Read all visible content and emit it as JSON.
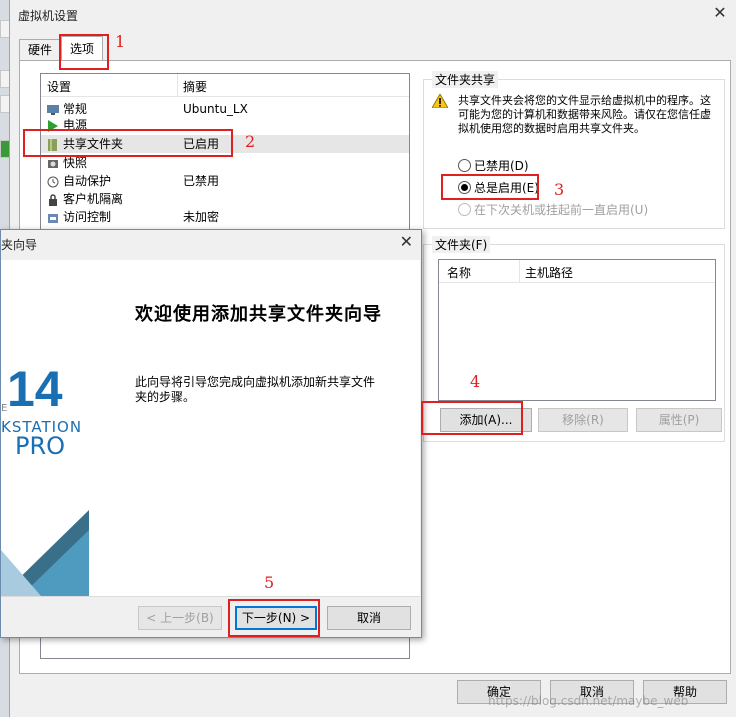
{
  "main_window": {
    "title": "虚拟机设置",
    "tabs": [
      {
        "label": "硬件"
      },
      {
        "label": "选项"
      }
    ],
    "settings_list": {
      "columns": [
        "设置",
        "摘要"
      ],
      "rows": [
        {
          "name": "常规",
          "summary": "Ubuntu_LX",
          "icon": "monitor-icon"
        },
        {
          "name": "电源",
          "summary": "",
          "icon": "play-icon"
        },
        {
          "name": "共享文件夹",
          "summary": "已启用",
          "icon": "shared-folder-icon"
        },
        {
          "name": "快照",
          "summary": "",
          "icon": "snapshot-icon"
        },
        {
          "name": "自动保护",
          "summary": "已禁用",
          "icon": "clock-icon"
        },
        {
          "name": "客户机隔离",
          "summary": "",
          "icon": "lock-icon"
        },
        {
          "name": "访问控制",
          "summary": "未加密",
          "icon": "access-control-icon"
        }
      ]
    },
    "folder_sharing": {
      "group_label": "文件夹共享",
      "warning": "共享文件夹会将您的文件显示给虚拟机中的程序。这可能为您的计算机和数据带来风险。请仅在您信任虚拟机使用您的数据时启用共享文件夹。",
      "options": [
        {
          "label": "已禁用(D)",
          "selected": false,
          "disabled": false
        },
        {
          "label": "总是启用(E)",
          "selected": true,
          "disabled": false
        },
        {
          "label": "在下次关机或挂起前一直启用(U)",
          "selected": false,
          "disabled": true
        }
      ]
    },
    "folders": {
      "group_label": "文件夹(F)",
      "columns": [
        "名称",
        "主机路径"
      ],
      "buttons": {
        "add": "添加(A)...",
        "remove": "移除(R)",
        "properties": "属性(P)"
      }
    },
    "footer": {
      "ok": "确定",
      "cancel": "取消",
      "help": "帮助"
    },
    "watermark": "https://blog.csdn.net/maybe_web"
  },
  "wizard": {
    "title": "夹向导",
    "heading": "欢迎使用添加共享文件夹向导",
    "description": "此向导将引导您完成向虚拟机添加新共享文件夹的步骤。",
    "branding": {
      "version": "14",
      "partial_product": "KSTATION",
      "edition": "PRO",
      "partial_letter": "E"
    },
    "buttons": {
      "back": "< 上一步(B)",
      "next": "下一步(N) >",
      "cancel": "取消"
    }
  },
  "annotations": [
    "1",
    "2",
    "3",
    "4",
    "5"
  ],
  "colors": {
    "annotation_red": "#e02020",
    "accent_blue": "#0078d7",
    "brand_blue": "#1a6fb3"
  }
}
